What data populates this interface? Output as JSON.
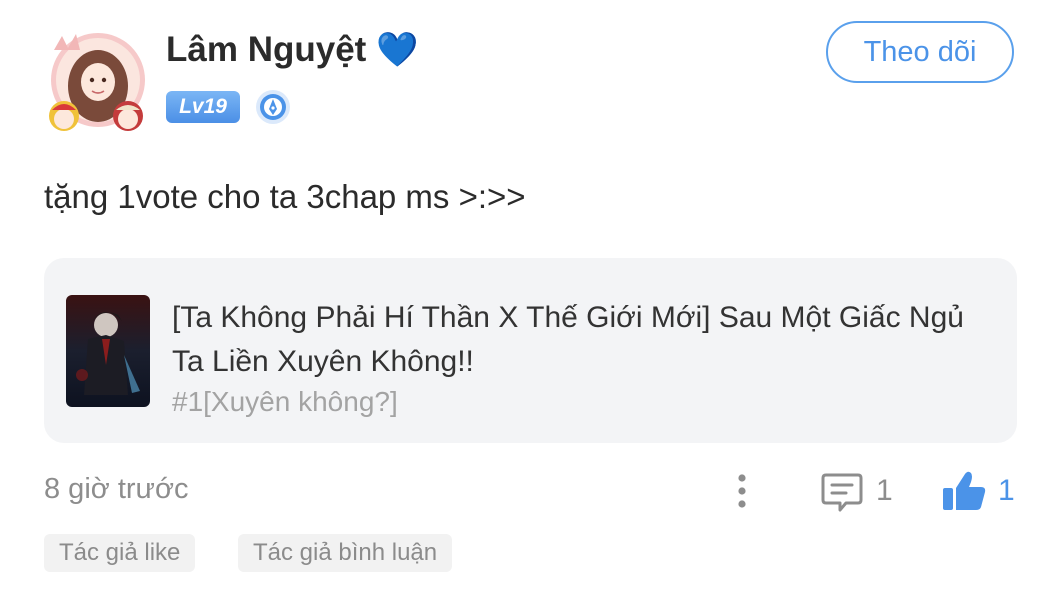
{
  "user": {
    "name": "Lâm Nguyệt",
    "name_emoji": "💙",
    "level": "Lv19"
  },
  "follow_button": "Theo dõi",
  "post": {
    "text": "tặng 1vote cho ta 3chap ms >:>>",
    "time": "8 giờ trước",
    "comment_count": "1",
    "like_count": "1"
  },
  "story": {
    "title": "[Ta Không Phải Hí Thần X Thế Giới Mới] Sau Một Giấc Ngủ Ta Liền Xuyên Không!!",
    "chapter": "#1[Xuyên không?]"
  },
  "tags": [
    "Tác giả like",
    "Tác giả bình luận"
  ],
  "colors": {
    "accent": "#4b93e8",
    "muted": "#8d8d8d",
    "card_bg": "#f3f4f6"
  }
}
